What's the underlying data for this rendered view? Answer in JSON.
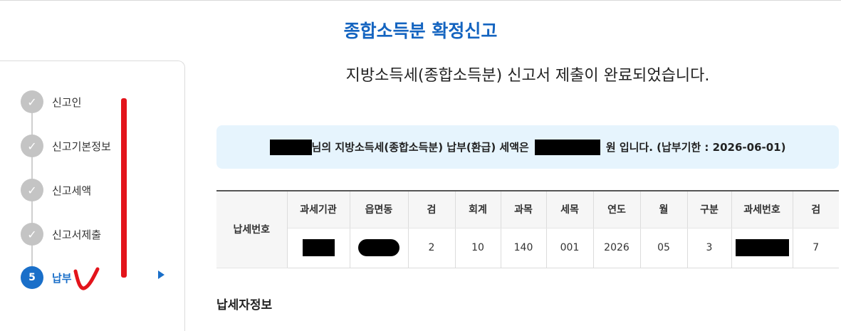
{
  "page_title": "종합소득분 확정신고",
  "steps": [
    {
      "label": "신고인",
      "icon": "check-icon",
      "state": "done"
    },
    {
      "label": "신고기본정보",
      "icon": "check-icon",
      "state": "done"
    },
    {
      "label": "신고세액",
      "icon": "check-icon",
      "state": "done"
    },
    {
      "label": "신고서제출",
      "icon": "check-icon",
      "state": "done"
    },
    {
      "label": "납부",
      "number": "5",
      "state": "active"
    }
  ],
  "completion_message": "지방소득세(종합소득분) 신고서 제출이 완료되었습니다.",
  "notice": {
    "part1": "님의 지방소득세(종합소득분) 납부(환급) 세액은",
    "part2": "원 입니다. (납부기한 : 2026-06-01)"
  },
  "tax_table": {
    "row_header": "납세번호",
    "columns": [
      "과세기관",
      "읍면동",
      "검",
      "회계",
      "과목",
      "세목",
      "연도",
      "월",
      "구분",
      "과세번호",
      "검"
    ],
    "values": [
      "",
      "",
      "2",
      "10",
      "140",
      "001",
      "2026",
      "05",
      "3",
      "",
      "7"
    ]
  },
  "section_title": "납세자정보",
  "colors": {
    "accent": "#1a6fc9",
    "title": "#1464c0",
    "notice_bg": "#e6f4fd",
    "annotation": "#e3141b"
  }
}
